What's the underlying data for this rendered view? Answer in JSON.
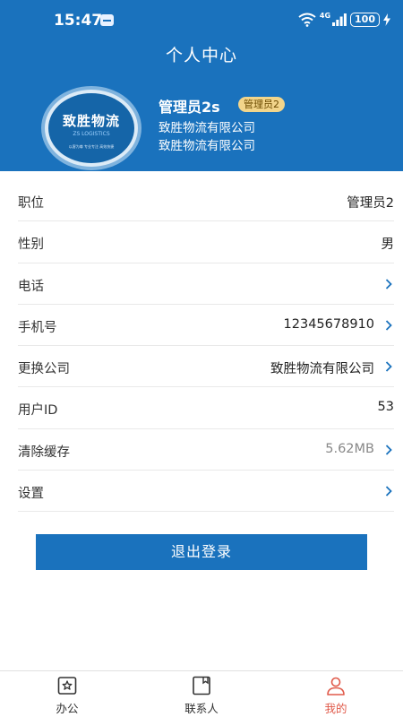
{
  "status": {
    "time": "15:47",
    "network": "4G",
    "battery": "100"
  },
  "header": {
    "title": "个人中心",
    "user_name": "管理员2s",
    "role_badge": "管理员2",
    "company_line1": "致胜物流有限公司",
    "company_line2": "致胜物流有限公司",
    "logo": {
      "name_cn": "致胜物流",
      "name_en": "ZS LOGISTICS",
      "slogan": "以客为尊 专业专注 高效快捷"
    }
  },
  "rows": [
    {
      "label": "职位",
      "value": "管理员2",
      "chevron": false
    },
    {
      "label": "性别",
      "value": "男",
      "chevron": false
    },
    {
      "label": "电话",
      "value": "",
      "chevron": true
    },
    {
      "label": "手机号",
      "value": "12345678910",
      "chevron": true
    },
    {
      "label": "更换公司",
      "value": "致胜物流有限公司",
      "chevron": true
    },
    {
      "label": "用户ID",
      "value": "53",
      "chevron": false
    },
    {
      "label": "清除缓存",
      "value": "5.62MB",
      "chevron": true
    },
    {
      "label": "设置",
      "value": "",
      "chevron": true
    }
  ],
  "logout_label": "退出登录",
  "tabs": [
    {
      "label": "办公",
      "icon": "star-box-icon",
      "active": false
    },
    {
      "label": "联系人",
      "icon": "contact-book-icon",
      "active": false
    },
    {
      "label": "我的",
      "icon": "user-icon",
      "active": true
    }
  ],
  "colors": {
    "brand": "#1a72bd",
    "active_tab": "#e05a4a",
    "badge": "#f2d58b"
  }
}
